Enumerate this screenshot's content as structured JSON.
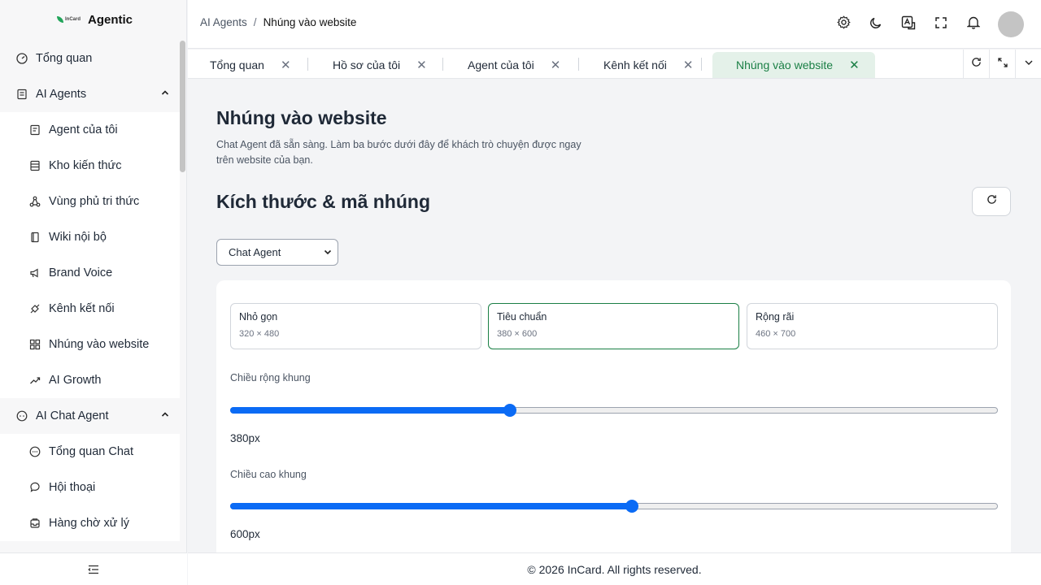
{
  "app": {
    "name": "Agentic",
    "logo_text": "InCard"
  },
  "sidebar": {
    "items": [
      {
        "label": "Tổng quan",
        "icon": "dashboard-icon",
        "type": "top"
      },
      {
        "label": "AI Agents",
        "icon": "agent-icon",
        "type": "group",
        "expanded": true
      },
      {
        "label": "Agent của tôi",
        "icon": "robot-icon",
        "type": "sub"
      },
      {
        "label": "Kho kiến thức",
        "icon": "database-icon",
        "type": "sub"
      },
      {
        "label": "Vùng phủ tri thức",
        "icon": "network-icon",
        "type": "sub"
      },
      {
        "label": "Wiki nội bộ",
        "icon": "book-icon",
        "type": "sub"
      },
      {
        "label": "Brand Voice",
        "icon": "megaphone-icon",
        "type": "sub"
      },
      {
        "label": "Kênh kết nối",
        "icon": "plug-icon",
        "type": "sub"
      },
      {
        "label": "Nhúng vào website",
        "icon": "grid-icon",
        "type": "sub"
      },
      {
        "label": "AI Growth",
        "icon": "trending-up-icon",
        "type": "sub"
      },
      {
        "label": "AI Chat Agent",
        "icon": "chat-bot-icon",
        "type": "group",
        "expanded": true
      },
      {
        "label": "Tổng quan Chat",
        "icon": "chat-icon",
        "type": "sub"
      },
      {
        "label": "Hội thoại",
        "icon": "messages-icon",
        "type": "sub"
      },
      {
        "label": "Hàng chờ xử lý",
        "icon": "inbox-icon",
        "type": "sub"
      }
    ]
  },
  "header": {
    "breadcrumb": [
      "AI Agents",
      "Nhúng vào website"
    ],
    "breadcrumb_sep": "/"
  },
  "tabs": [
    {
      "label": "Tổng quan",
      "active": false
    },
    {
      "label": "Hồ sơ của tôi",
      "active": false
    },
    {
      "label": "Agent của tôi",
      "active": false
    },
    {
      "label": "Kênh kết nối",
      "active": false
    },
    {
      "label": "Nhúng vào website",
      "active": true
    }
  ],
  "main": {
    "title": "Nhúng vào website",
    "description": "Chat Agent đã sẵn sàng. Làm ba bước dưới đây để khách trò chuyện được ngay trên website của bạn.",
    "section_title": "Kích thước & mã nhúng",
    "agent_select": {
      "value": "Chat Agent"
    },
    "size_options": [
      {
        "name": "Nhỏ gọn",
        "dims": "320 × 480",
        "selected": false
      },
      {
        "name": "Tiêu chuẩn",
        "dims": "380 × 600",
        "selected": true
      },
      {
        "name": "Rộng rãi",
        "dims": "460 × 700",
        "selected": false
      }
    ],
    "width_field": {
      "label": "Chiều rộng khung",
      "value": "380px",
      "fraction": 0.364
    },
    "height_field": {
      "label": "Chiều cao khung",
      "value": "600px",
      "fraction": 0.523
    }
  },
  "footer": {
    "text": "© 2026 InCard. All rights reserved."
  },
  "colors": {
    "accent": "#1a7f45",
    "active_tab_bg": "#e4f1e9",
    "slider": "#0b6bf5"
  }
}
